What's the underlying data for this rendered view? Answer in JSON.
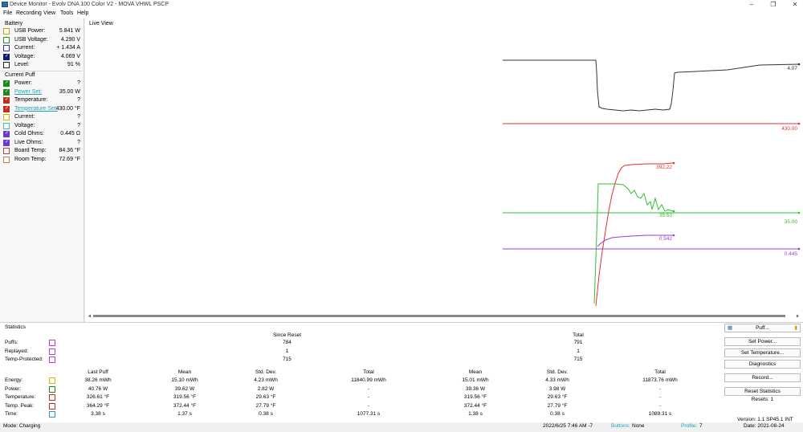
{
  "window": {
    "title": "Device Monitor - Evolv DNA 100 Color V2 - MOVA VHWL PSCP",
    "controls": [
      "–",
      "❐",
      "✕"
    ]
  },
  "menu": [
    "File",
    "Recording",
    "View",
    "Tools",
    "Help"
  ],
  "battery": {
    "header": "Battery",
    "items": [
      {
        "label": "USB Power:",
        "value": "5.841 W",
        "color": "#c8a000",
        "checked": false
      },
      {
        "label": "USB Voltage:",
        "value": "4.290 V",
        "color": "#2e8b2e",
        "checked": false
      },
      {
        "label": "Current:",
        "value": "+ 1.434 A",
        "color": "#3a2fd0",
        "checked": false
      },
      {
        "label": "Voltage:",
        "value": "4.069 V",
        "color": "#102070",
        "checked": true
      },
      {
        "label": "Level:",
        "value": "91 %",
        "color": "#222222",
        "checked": false
      }
    ]
  },
  "current_puff": {
    "header": "Current Puff",
    "items": [
      {
        "label": "Power:",
        "value": "?",
        "color": "#1a8a1a",
        "checked": true,
        "link": false
      },
      {
        "label": "Power Set:",
        "value": "35.00 W",
        "color": "#1a8a1a",
        "checked": true,
        "link": true
      },
      {
        "label": "Temperature:",
        "value": "?",
        "color": "#c03020",
        "checked": true,
        "link": false
      },
      {
        "label": "Temperature Set:",
        "value": "430.00 °F",
        "color": "#c03020",
        "checked": true,
        "link": true
      },
      {
        "label": "Current:",
        "value": "?",
        "color": "#d6b800",
        "checked": false,
        "link": false
      },
      {
        "label": "Voltage:",
        "value": "?",
        "color": "#40c0b0",
        "checked": false,
        "link": false
      },
      {
        "label": "Cold Ohms:",
        "value": "0.445 Ω",
        "color": "#6a3ad0",
        "checked": true,
        "link": false
      },
      {
        "label": "Live Ohms:",
        "value": "?",
        "color": "#6a3ad0",
        "checked": true,
        "link": false
      },
      {
        "label": "Board Temp:",
        "value": "84.36 °F",
        "color": "#b04040",
        "checked": false,
        "link": false
      },
      {
        "label": "Room Temp:",
        "value": "72.69 °F",
        "color": "#c08040",
        "checked": false,
        "link": false
      }
    ]
  },
  "live_view": {
    "header": "Live View",
    "labels": {
      "voltage": "4.07",
      "temp_set": "430.00",
      "temp_live": "392.22",
      "power_live": "35.53",
      "power_set": "35.00",
      "ohms_live": "0.542",
      "ohms_cold": "0.445"
    },
    "colors": {
      "voltage": "#333333",
      "temp": "#e03030",
      "power": "#30c030",
      "ohms": "#9040d0"
    }
  },
  "stats": {
    "header": "Statistics",
    "since_reset": "Since Reset",
    "total": "Total",
    "count_rows": [
      {
        "label": "Puffs:",
        "since": "784",
        "total": "791"
      },
      {
        "label": "Replayed:",
        "since": "1",
        "total": "1"
      },
      {
        "label": "Temp-Protected:",
        "since": "715",
        "total": "715"
      }
    ],
    "columns": [
      "Last Puff",
      "Mean",
      "Std. Dev.",
      "Total",
      "Mean",
      "Std. Dev.",
      "Total"
    ],
    "rows": [
      {
        "label": "Energy:",
        "color": "#d6b800",
        "cells": [
          "38.26 mWh",
          "15.10 mWh",
          "4.23 mWh",
          "11840.99 mWh",
          "15.01 mWh",
          "4.33 mWh",
          "11873.76 mWh"
        ]
      },
      {
        "label": "Power:",
        "color": "#1a8a1a",
        "cells": [
          "40.76 W",
          "39.62 W",
          "2.82 W",
          "-",
          "39.36 W",
          "3.98 W",
          "-"
        ]
      },
      {
        "label": "Temperature:",
        "color": "#c03020",
        "cells": [
          "326.61 °F",
          "319.56 °F",
          "29.63 °F",
          "-",
          "319.56 °F",
          "29.63 °F",
          "-"
        ]
      },
      {
        "label": "Temp. Peak:",
        "color": "#c03020",
        "cells": [
          "364.29 °F",
          "372.44 °F",
          "27.79 °F",
          "-",
          "372.44 °F",
          "27.79 °F",
          "-"
        ]
      },
      {
        "label": "Time:",
        "color": "#2f8fe0",
        "cells": [
          "3.38 s",
          "1.37 s",
          "0.38 s",
          "1077.31 s",
          "1.38 s",
          "0.38 s",
          "1089.31 s"
        ]
      }
    ]
  },
  "buttons": {
    "puff": "Puff...",
    "set_power": "Set Power...",
    "set_temperature": "Set Temperature...",
    "diagnostics": "Diagnostics",
    "record": "Record...",
    "reset_statistics": "Reset Statistics",
    "resets": "Resets: 1"
  },
  "status": {
    "mode": "Mode: Charging",
    "datetime": "2022/6/25 7:46 AM -7",
    "buttons_label": "Buttons:",
    "buttons_value": "None",
    "profile_label": "Profile:",
    "profile_value": "7",
    "version": "Version: 1.1 SP45.1 INT",
    "date": "Date: 2021-08-24"
  }
}
